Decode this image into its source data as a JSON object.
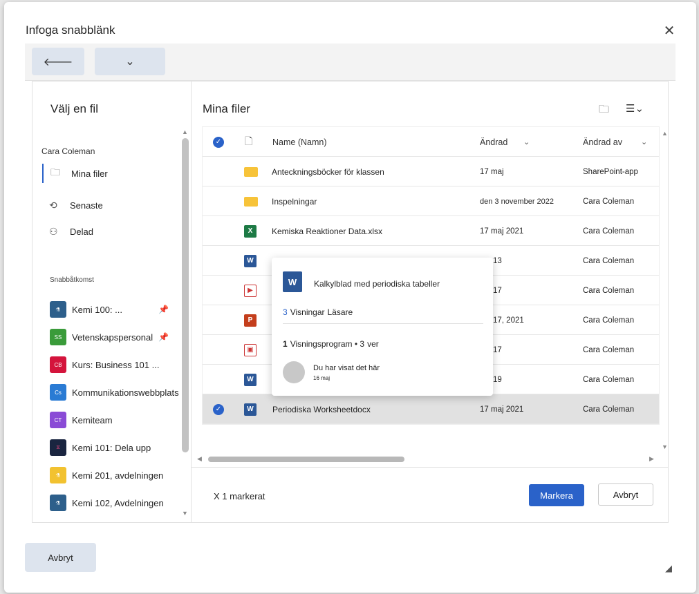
{
  "dialog": {
    "title": "Infoga snabblänk",
    "close_icon": "close-icon",
    "cancel_label": "Avbryt"
  },
  "toolbar": {
    "back_icon": "back-arrow-icon",
    "dropdown_icon": "chevron-down-icon"
  },
  "left": {
    "title": "Välj en fil",
    "user": "Cara Coleman",
    "nav": [
      {
        "label": "Mina filer",
        "icon": "folder-icon"
      },
      {
        "label": "Senaste",
        "icon": "history-icon"
      },
      {
        "label": "Delad",
        "icon": "people-icon"
      }
    ],
    "quick_heading": "Snabbåtkomst",
    "quick": [
      {
        "label": "Kemi 100: ...",
        "tile": "",
        "color": "#2d5f8b",
        "pinned": true
      },
      {
        "label": "Vetenskapspersonal",
        "tile": "SS",
        "color": "#3a9b3a",
        "pinned": true
      },
      {
        "label": "Kurs: Business 101 ...",
        "tile": "CB",
        "color": "#d4143c",
        "pinned": false
      },
      {
        "label": "Kommunikationswebbplats",
        "tile": "Cs",
        "color": "#2a7bd4",
        "pinned": false
      },
      {
        "label": "Kemiteam",
        "tile": "CT",
        "color": "#8a4bd6",
        "pinned": false
      },
      {
        "label": "Kemi 101: Dela upp",
        "tile": "",
        "color": "#1a2540",
        "pinned": false
      },
      {
        "label": "Kemi 201, avdelningen",
        "tile": "",
        "color": "#f2c230",
        "pinned": false
      },
      {
        "label": "Kemi 102, Avdelningen",
        "tile": "",
        "color": "#2d5f8b",
        "pinned": false
      }
    ]
  },
  "files": {
    "title": "Mina filer",
    "new_folder_icon": "new-folder-icon",
    "sort_icon": "sort-icon",
    "columns": {
      "name": "Name (Namn)",
      "modified": "Ändrad",
      "modified_by": "Ändrad av"
    },
    "rows": [
      {
        "name": "Anteckningsböcker för klassen",
        "type": "folder",
        "modified": "17 maj",
        "by": "SharePoint-app"
      },
      {
        "name": "Inspelningar",
        "type": "folder",
        "modified": "den 3 november 2022",
        "by": "Cara Coleman"
      },
      {
        "name": "Kemiska Reaktioner Data.xlsx",
        "type": "excel",
        "modified": "17 maj 2021",
        "by": "Cara Coleman"
      },
      {
        "name": "",
        "type": "word",
        "modified": "13",
        "by": "Cara Coleman"
      },
      {
        "name": "",
        "type": "video",
        "modified": "17",
        "by": "Cara Coleman"
      },
      {
        "name": "",
        "type": "ppt",
        "modified": "17, 2021",
        "by": "Cara Coleman"
      },
      {
        "name": "",
        "type": "video2",
        "modified": "17",
        "by": "Cara Coleman"
      },
      {
        "name": "",
        "type": "word",
        "modified": "19",
        "by": "Cara Coleman"
      },
      {
        "name": "Periodiska Worksheetdocx",
        "type": "word",
        "modified": "17 maj 2021",
        "by": "Cara Coleman",
        "selected": true
      }
    ]
  },
  "hovercard": {
    "file_name": "Kalkylblad med periodiska tabeller",
    "views_count": "3",
    "views_label": "Visningar",
    "readers_label": "Läsare",
    "viewers_count": "1",
    "viewers_text": "Visningsprogram • 3 ",
    "viewers_suffix": "ver",
    "activity": "Du har visat det här",
    "activity_date": "16 maj"
  },
  "footer": {
    "selected_text": "X 1 markerat",
    "select_label": "Markera",
    "cancel_label": "Avbryt"
  }
}
